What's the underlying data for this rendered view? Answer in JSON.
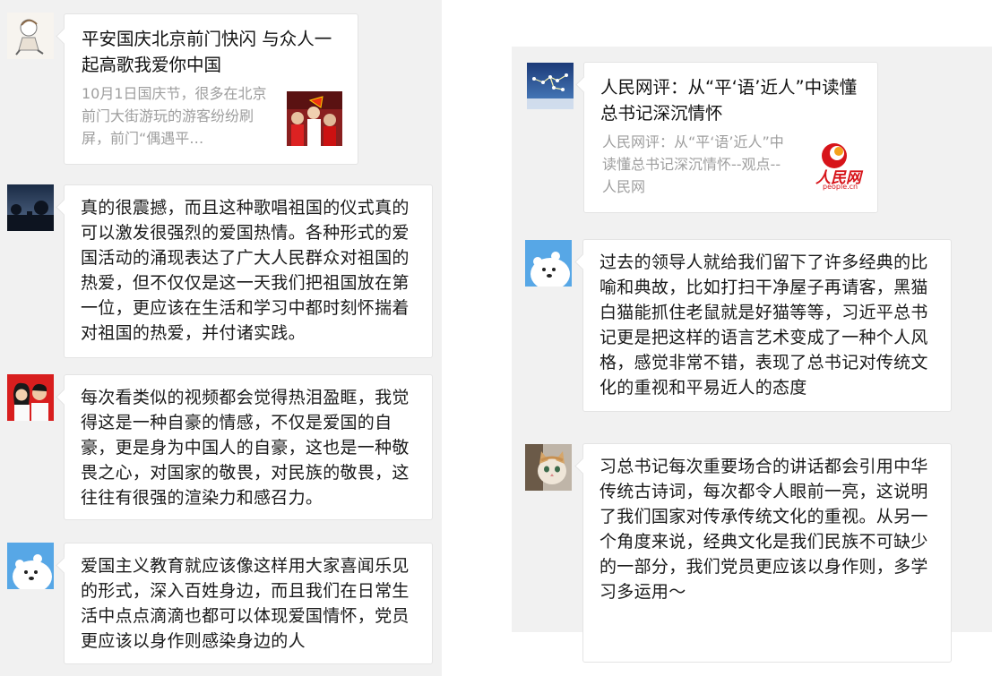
{
  "left_panel": {
    "share_card": {
      "title": "平安国庆北京前门快闪  与众人一起高歌我爱你中国",
      "description": "10月1日国庆节，很多在北京前门大街游玩的游客纷纷刷屏，前门“偶遇平…"
    },
    "comments": [
      {
        "text": "真的很震撼，而且这种歌唱祖国的仪式真的可以激发很强烈的爱国热情。各种形式的爱国活动的涌现表达了广大人民群众对祖国的热爱，但不仅仅是这一天我们把祖国放在第一位，更应该在生活和学习中都时刻怀揣着对祖国的热爱，并付诸实践。"
      },
      {
        "text": "每次看类似的视频都会觉得热泪盈眶，我觉得这是一种自豪的情感，不仅是爱国的自豪，更是身为中国人的自豪，这也是一种敬畏之心，对国家的敬畏，对民族的敬畏，这往往有很强的渲染力和感召力。"
      },
      {
        "text": "爱国主义教育就应该像这样用大家喜闻乐见的形式，深入百姓身边，而且我们在日常生活中点点滴滴也都可以体现爱国情怀，党员更应该以身作则感染身边的人"
      }
    ]
  },
  "right_panel": {
    "share_card": {
      "title": "人民网评：从“平‘语’近人”中读懂总书记深沉情怀",
      "description": "人民网评：从“平‘语’近人”中读懂总书记深沉情怀--观点--人民网",
      "logo_text": "人民网",
      "logo_sub": "people.cn"
    },
    "comments": [
      {
        "text": "过去的领导人就给我们留下了许多经典的比喻和典故，比如打扫干净屋子再请客，黑猫白猫能抓住老鼠就是好猫等等，习近平总书记更是把这样的语言艺术变成了一种个人风格，感觉非常不错，表现了总书记对传统文化的重视和平易近人的态度"
      },
      {
        "text": "习总书记每次重要场合的讲话都会引用中华传统古诗词，每次都令人眼前一亮，这说明了我们国家对传承传统文化的重视。从另一个角度来说，经典文化是我们民族不可缺少的一部分，我们党员更应该以身作则，多学习多运用～"
      }
    ]
  },
  "colors": {
    "panel_bg": "#f1f1f1",
    "bubble_bg": "#ffffff",
    "text": "#1a1a1a",
    "desc_text": "#9e9e9e",
    "logo_red": "#d7141a"
  }
}
